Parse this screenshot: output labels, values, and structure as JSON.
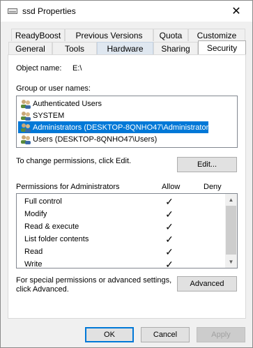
{
  "window": {
    "title": "ssd Properties",
    "close_glyph": "✕"
  },
  "tabs": {
    "row1": [
      "ReadyBoost",
      "Previous Versions",
      "Quota",
      "Customize"
    ],
    "row2": [
      "General",
      "Tools",
      "Hardware",
      "Sharing",
      "Security"
    ],
    "active": "Security"
  },
  "security": {
    "object_name_label": "Object name:",
    "object_name_value": "E:\\",
    "group_label": "Group or user names:",
    "users": [
      "Authenticated Users",
      "SYSTEM",
      "Administrators (DESKTOP-8QNHO47\\Administrators)",
      "Users (DESKTOP-8QNHO47\\Users)"
    ],
    "selected_user": "Administrators (DESKTOP-8QNHO47\\Administrators)",
    "change_text": "To change permissions, click Edit.",
    "edit_label": "Edit...",
    "permissions_label": "Permissions for Administrators",
    "allow_header": "Allow",
    "deny_header": "Deny",
    "permissions": [
      {
        "name": "Full control",
        "allow": "✓",
        "deny": ""
      },
      {
        "name": "Modify",
        "allow": "✓",
        "deny": ""
      },
      {
        "name": "Read & execute",
        "allow": "✓",
        "deny": ""
      },
      {
        "name": "List folder contents",
        "allow": "✓",
        "deny": ""
      },
      {
        "name": "Read",
        "allow": "✓",
        "deny": ""
      },
      {
        "name": "Write",
        "allow": "✓",
        "deny": ""
      }
    ],
    "advanced_text_line1": "For special permissions or advanced settings,",
    "advanced_text_line2": "click Advanced.",
    "advanced_label": "Advanced"
  },
  "footer": {
    "ok_label": "OK",
    "cancel_label": "Cancel",
    "apply_label": "Apply"
  },
  "colors": {
    "selection": "#0078d7",
    "panel": "#ffffff",
    "window_bg": "#f0f0f0"
  }
}
